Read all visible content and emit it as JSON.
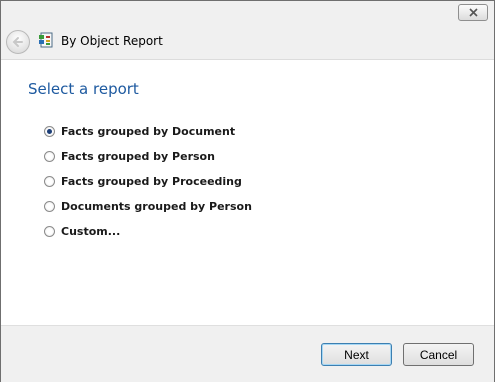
{
  "window": {
    "close_icon": "close-icon"
  },
  "header": {
    "back_icon": "back-arrow-icon",
    "app_icon": "report-icon",
    "title": "By Object Report"
  },
  "main": {
    "heading": "Select a report",
    "options": [
      {
        "label": "Facts grouped by Document",
        "checked": true
      },
      {
        "label": "Facts grouped by Person",
        "checked": false
      },
      {
        "label": "Facts grouped by Proceeding",
        "checked": false
      },
      {
        "label": "Documents grouped by Person",
        "checked": false
      },
      {
        "label": "Custom...",
        "checked": false
      }
    ]
  },
  "footer": {
    "next_label": "Next",
    "cancel_label": "Cancel"
  }
}
